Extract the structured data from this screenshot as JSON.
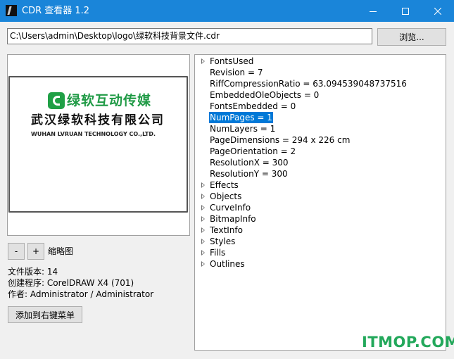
{
  "titlebar": {
    "title": "CDR 查看器 1.2",
    "app_icon": "cdr-app-icon",
    "controls": [
      "minimize-icon",
      "maximize-icon",
      "close-icon"
    ]
  },
  "file": {
    "path": "C:\\Users\\admin\\Desktop\\logo\\绿软科技背景文件.cdr",
    "browse_label": "浏览..."
  },
  "preview": {
    "logo_slogan": "绿软互动传媒",
    "logo_company_cn": "武汉绿软科技有限公司",
    "logo_company_en": "WUHAN LVRUAN TECHNOLOGY CO.,LTD.",
    "logo_color": "#1f9a45"
  },
  "thumbnail": {
    "minus_label": "-",
    "plus_label": "+",
    "label": "缩略图"
  },
  "info": {
    "version": "文件版本: 14",
    "creator": "创建程序: CorelDRAW X4 (701)",
    "author": "作者: Administrator / Administrator"
  },
  "context_menu_button": "添加到右键菜单",
  "tree": {
    "selection_color": "#0078d7",
    "items": [
      {
        "label": "FontsUsed",
        "expandable": true
      },
      {
        "label": "Revision = 7",
        "expandable": false
      },
      {
        "label": "RiffCompressionRatio = 63.094539048737516",
        "expandable": false
      },
      {
        "label": "EmbeddedOleObjects = 0",
        "expandable": false
      },
      {
        "label": "FontsEmbedded = 0",
        "expandable": false
      },
      {
        "label": "NumPages = 1",
        "expandable": false,
        "selected": true
      },
      {
        "label": "NumLayers = 1",
        "expandable": false
      },
      {
        "label": "PageDimensions = 294 x 226 cm",
        "expandable": false
      },
      {
        "label": "PageOrientation = 2",
        "expandable": false
      },
      {
        "label": "ResolutionX = 300",
        "expandable": false
      },
      {
        "label": "ResolutionY = 300",
        "expandable": false
      },
      {
        "label": "Effects",
        "expandable": true
      },
      {
        "label": "Objects",
        "expandable": true
      },
      {
        "label": "CurveInfo",
        "expandable": true
      },
      {
        "label": "BitmapInfo",
        "expandable": true
      },
      {
        "label": "TextInfo",
        "expandable": true
      },
      {
        "label": "Styles",
        "expandable": true
      },
      {
        "label": "Fills",
        "expandable": true
      },
      {
        "label": "Outlines",
        "expandable": true
      }
    ]
  },
  "watermark": {
    "text": "ITMOP.COM",
    "color": "#23a85b"
  }
}
